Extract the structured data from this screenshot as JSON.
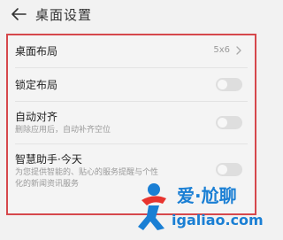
{
  "header": {
    "title": "桌面设置",
    "back_icon": "back-arrow-icon"
  },
  "settings": {
    "desktop_layout": {
      "title": "桌面布局",
      "value": "5x6"
    },
    "lock_layout": {
      "title": "锁定布局",
      "enabled": false
    },
    "auto_align": {
      "title": "自动对齐",
      "subtitle": "删除应用后，自动补齐空位",
      "enabled": false
    },
    "smart_assistant": {
      "title": "智慧助手·今天",
      "subtitle_line1": "为您提供智能的、贴心的服务提醒与个性",
      "subtitle_line2": "化的新闻资讯服务",
      "enabled": false
    }
  },
  "watermark": {
    "brand": "爱·尬聊",
    "url": "igaliao.com"
  },
  "colors": {
    "highlight_border": "#d6484c",
    "toggle_off": "#dedede",
    "watermark_blue": "#1a7fd4",
    "watermark_red": "#e8342f"
  }
}
